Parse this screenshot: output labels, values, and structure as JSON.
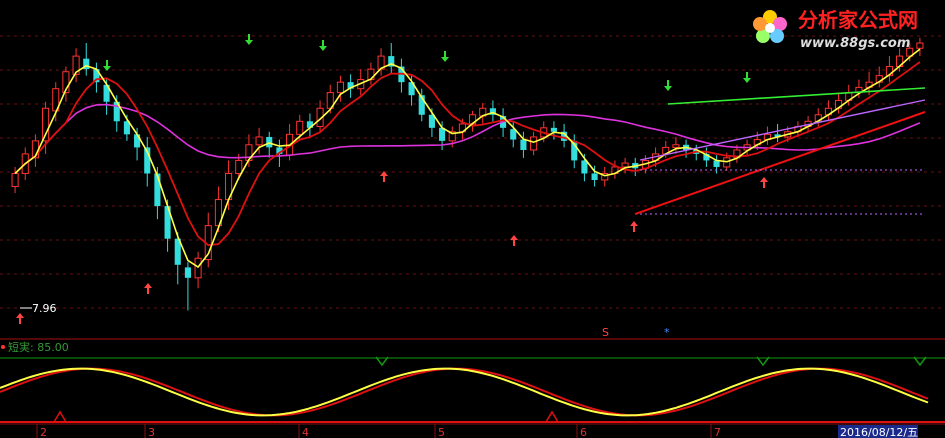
{
  "logo": {
    "title": "分析家公式网",
    "url": "www.88gs.com"
  },
  "price_label": "7.96",
  "indicator": {
    "label": "短実: 85.00"
  },
  "date_badge": "2016/08/12/五",
  "colors": {
    "background": "#000000",
    "up_candle": "#ff3333",
    "down_candle": "#33dddd",
    "ma_yellow": "#ffff44",
    "ma_red": "#dd1111",
    "ma_magenta": "#dd33dd",
    "trend_green": "#33ee33",
    "trend_red": "#ee1111",
    "trend_violet": "#bb66ff",
    "arrow_up": "#ff4444",
    "arrow_down": "#33dd33",
    "grid_red": "#661111",
    "osc_yellow": "#ffff44",
    "osc_red": "#dd1111",
    "osc_green": "#119911"
  },
  "chart_data": {
    "type": "candlestick",
    "x_axis": [
      "2",
      "3",
      "4",
      "5",
      "6",
      "7"
    ],
    "candles": [
      [
        190,
        200,
        185,
        205
      ],
      [
        200,
        215,
        195,
        220
      ],
      [
        212,
        225,
        205,
        230
      ],
      [
        225,
        250,
        215,
        255
      ],
      [
        248,
        265,
        240,
        270
      ],
      [
        262,
        278,
        255,
        282
      ],
      [
        276,
        290,
        270,
        296
      ],
      [
        288,
        280,
        275,
        300
      ],
      [
        280,
        270,
        262,
        285
      ],
      [
        268,
        255,
        245,
        272
      ],
      [
        255,
        240,
        232,
        260
      ],
      [
        240,
        230,
        225,
        245
      ],
      [
        230,
        220,
        210,
        235
      ],
      [
        220,
        200,
        190,
        228
      ],
      [
        200,
        175,
        165,
        205
      ],
      [
        175,
        150,
        140,
        180
      ],
      [
        150,
        130,
        115,
        155
      ],
      [
        128,
        120,
        95,
        132
      ],
      [
        120,
        135,
        112,
        140
      ],
      [
        134,
        160,
        128,
        170
      ],
      [
        160,
        180,
        155,
        190
      ],
      [
        180,
        200,
        172,
        210
      ],
      [
        200,
        210,
        195,
        215
      ],
      [
        210,
        222,
        205,
        230
      ],
      [
        222,
        228,
        215,
        235
      ],
      [
        228,
        220,
        212,
        232
      ],
      [
        220,
        215,
        205,
        226
      ],
      [
        214,
        230,
        210,
        238
      ],
      [
        230,
        240,
        226,
        245
      ],
      [
        240,
        235,
        228,
        246
      ],
      [
        236,
        250,
        232,
        256
      ],
      [
        250,
        262,
        246,
        268
      ],
      [
        262,
        270,
        255,
        275
      ],
      [
        270,
        265,
        258,
        276
      ],
      [
        265,
        272,
        260,
        280
      ],
      [
        272,
        280,
        268,
        285
      ],
      [
        280,
        290,
        275,
        296
      ],
      [
        290,
        282,
        276,
        300
      ],
      [
        282,
        270,
        262,
        288
      ],
      [
        270,
        260,
        252,
        275
      ],
      [
        260,
        245,
        240,
        265
      ],
      [
        245,
        235,
        228,
        250
      ],
      [
        235,
        225,
        218,
        240
      ],
      [
        225,
        232,
        220,
        236
      ],
      [
        232,
        238,
        226,
        242
      ],
      [
        238,
        245,
        232,
        248
      ],
      [
        244,
        250,
        238,
        254
      ],
      [
        250,
        245,
        240,
        256
      ],
      [
        244,
        235,
        228,
        250
      ],
      [
        234,
        226,
        220,
        240
      ],
      [
        226,
        218,
        212,
        232
      ],
      [
        218,
        228,
        214,
        232
      ],
      [
        228,
        235,
        224,
        240
      ],
      [
        235,
        232,
        226,
        240
      ],
      [
        232,
        225,
        220,
        238
      ],
      [
        225,
        210,
        204,
        230
      ],
      [
        210,
        200,
        194,
        215
      ],
      [
        200,
        195,
        190,
        206
      ],
      [
        195,
        200,
        190,
        205
      ],
      [
        200,
        205,
        196,
        210
      ],
      [
        205,
        208,
        200,
        212
      ],
      [
        208,
        204,
        198,
        212
      ],
      [
        204,
        210,
        200,
        214
      ],
      [
        210,
        215,
        205,
        220
      ],
      [
        215,
        220,
        212,
        225
      ],
      [
        220,
        222,
        215,
        228
      ],
      [
        222,
        218,
        212,
        226
      ],
      [
        218,
        215,
        210,
        222
      ],
      [
        215,
        210,
        205,
        220
      ],
      [
        210,
        205,
        200,
        214
      ],
      [
        205,
        212,
        202,
        216
      ],
      [
        212,
        218,
        208,
        222
      ],
      [
        218,
        222,
        214,
        226
      ],
      [
        222,
        226,
        218,
        232
      ],
      [
        226,
        230,
        222,
        236
      ],
      [
        230,
        228,
        224,
        238
      ],
      [
        228,
        232,
        224,
        236
      ],
      [
        232,
        236,
        228,
        240
      ],
      [
        236,
        240,
        232,
        244
      ],
      [
        240,
        245,
        236,
        250
      ],
      [
        245,
        250,
        240,
        256
      ],
      [
        250,
        256,
        246,
        262
      ],
      [
        256,
        262,
        252,
        268
      ],
      [
        262,
        266,
        258,
        272
      ],
      [
        266,
        270,
        260,
        278
      ],
      [
        270,
        275,
        266,
        282
      ],
      [
        275,
        282,
        270,
        290
      ],
      [
        282,
        290,
        278,
        296
      ],
      [
        290,
        296,
        286,
        300
      ],
      [
        296,
        300,
        290,
        304
      ]
    ],
    "annotations": {
      "low_label": "7.96",
      "marker_s": "S",
      "marker_star": "*"
    }
  }
}
